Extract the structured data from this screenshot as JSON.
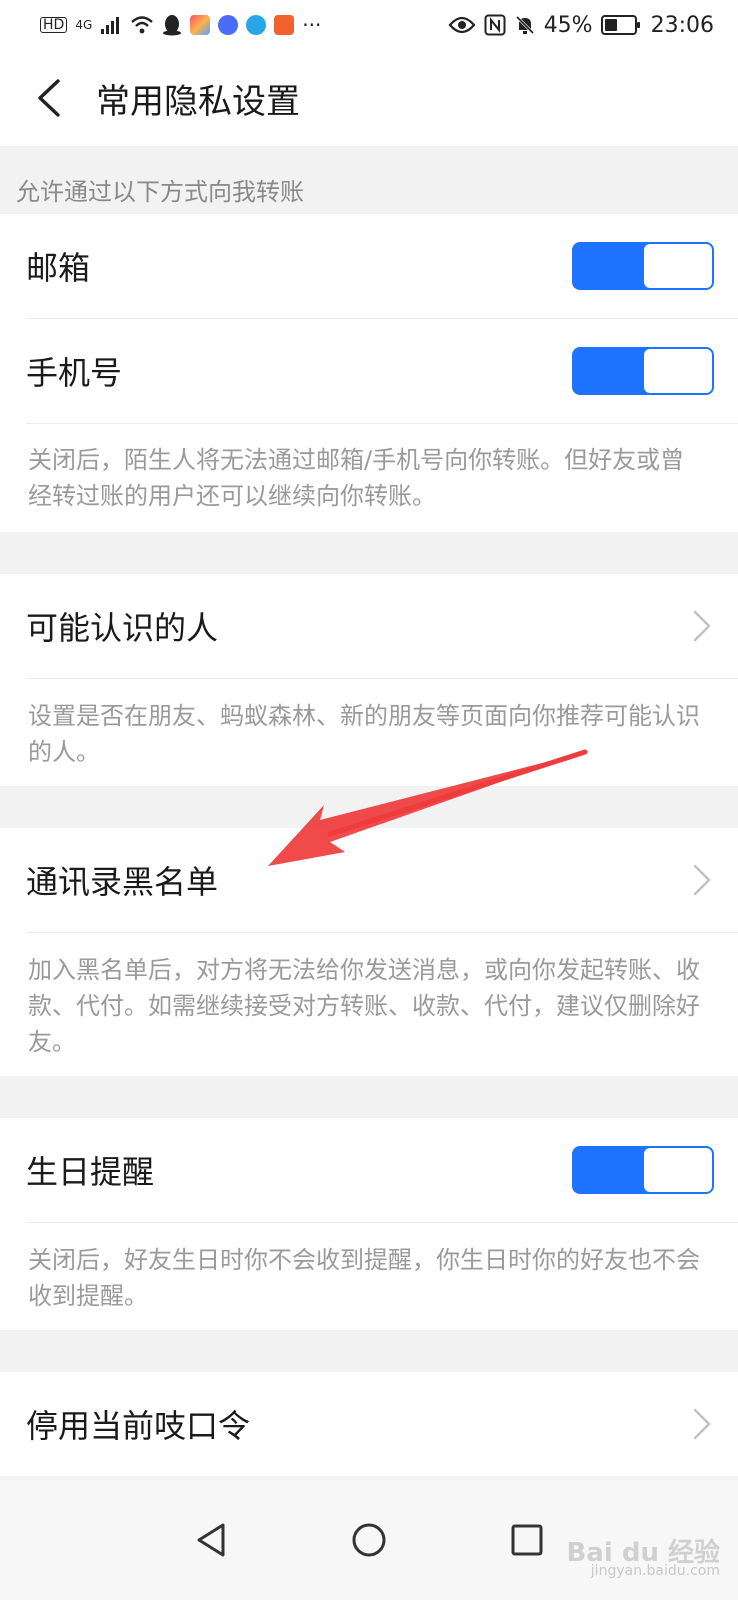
{
  "status_bar": {
    "network": "HD",
    "signal_type": "4G",
    "battery_percent": "45%",
    "battery_level": 0.45,
    "time": "23:06",
    "more": "···"
  },
  "header": {
    "title": "常用隐私设置"
  },
  "transfer_section": {
    "caption": "允许通过以下方式向我转账",
    "items": [
      {
        "label": "邮箱",
        "enabled": true
      },
      {
        "label": "手机号",
        "enabled": true
      }
    ],
    "description": "关闭后，陌生人将无法通过邮箱/手机号向你转账。但好友或曾经转过账的用户还可以继续向你转账。"
  },
  "people_section": {
    "label": "可能认识的人",
    "description": "设置是否在朋友、蚂蚁森林、新的朋友等页面向你推荐可能认识的人。"
  },
  "blacklist_section": {
    "label": "通讯录黑名单",
    "description": "加入黑名单后，对方将无法给你发送消息，或向你发起转账、收款、代付。如需继续接受对方转账、收款、代付，建议仅删除好友。"
  },
  "birthday_section": {
    "label": "生日提醒",
    "enabled": true,
    "description": "关闭后，好友生日时你不会收到提醒，你生日时你的好友也不会收到提醒。"
  },
  "password_section": {
    "label": "停用当前吱口令"
  },
  "watermark": {
    "brand": "Bai du 经验",
    "site": "jingyan.baidu.com"
  },
  "colors": {
    "accent": "#1f74ff",
    "annotation_arrow": "#ef3b3b"
  }
}
